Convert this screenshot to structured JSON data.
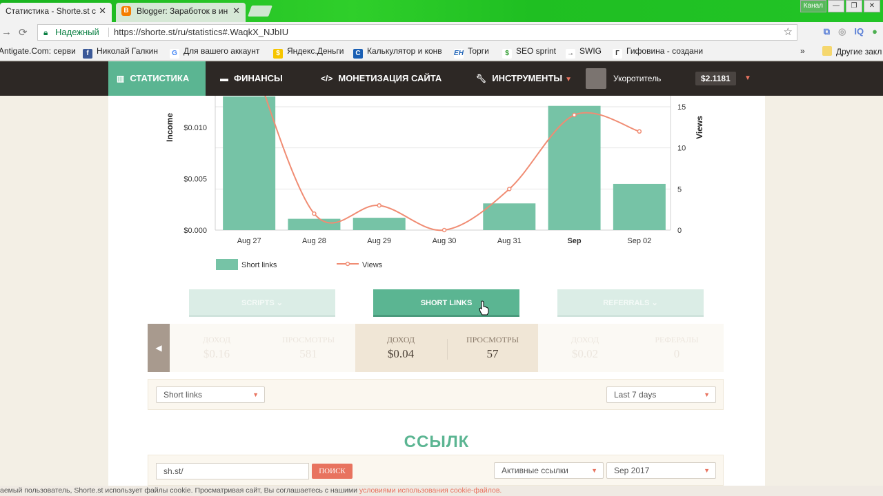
{
  "browser": {
    "tabs": [
      {
        "title": "Статистика - Shorte.st c"
      },
      {
        "title": "Blogger: Заработок в ин"
      }
    ],
    "window_user": "Канал",
    "secure_label": "Надежный",
    "url": "https://shorte.st/ru/statistics#.WaqkX_NJbIU",
    "bookmarks": [
      "Antigate.Com: серви",
      "Николай Галкин",
      "Для вашего аккаунт",
      "Яндекс.Деньги",
      "Калькулятор и конв",
      "Торги",
      "SEO sprint",
      "SWIG",
      "Гифовина - создани"
    ],
    "other_bookmarks": "Другие закл",
    "overflow": "»"
  },
  "nav": {
    "items": [
      "СТАТИСТИКА",
      "ФИНАНСЫ",
      "МОНЕТИЗАЦИЯ САЙТА",
      "ИНСТРУМЕНТЫ"
    ],
    "user": "Укоротитель",
    "balance": "$2.1181"
  },
  "chart_data": {
    "type": "bar",
    "categories": [
      "Aug 27",
      "Aug 28",
      "Aug 29",
      "Aug 30",
      "Aug 31",
      "Sep",
      "Sep 02"
    ],
    "series": [
      {
        "name": "Short links",
        "values": [
          0.0135,
          0.0011,
          0.0012,
          0.0,
          0.0026,
          0.0121,
          0.0045
        ],
        "color": "#76c3a6",
        "axis": "left"
      },
      {
        "name": "Views",
        "values": [
          22,
          2,
          3,
          0,
          5,
          14,
          12
        ],
        "color": "#f08c73",
        "axis": "right",
        "type": "line"
      }
    ],
    "ylabel": "Income",
    "y2label": "Views",
    "left_ticks": [
      "$0.000",
      "$0.005",
      "$0.010"
    ],
    "right_ticks": [
      "0",
      "5",
      "10",
      "15"
    ],
    "ylim": [
      0,
      0.01
    ],
    "y2lim": [
      0,
      15
    ],
    "bold_category": "Sep",
    "legend": "bottom-left"
  },
  "toggles": [
    "SCRIPTS",
    "SHORT LINKS",
    "REFERRALS"
  ],
  "stats": {
    "left": [
      {
        "label": "ДОХОД",
        "value": "$0.16"
      },
      {
        "label": "ПРОСМОТРЫ",
        "value": "581"
      }
    ],
    "center": [
      {
        "label": "ДОХОД",
        "value": "$0.04"
      },
      {
        "label": "ПРОСМОТРЫ",
        "value": "57"
      }
    ],
    "right": [
      {
        "label": "ДОХОД",
        "value": "$0.02"
      },
      {
        "label": "РЕФЕРАЛЫ",
        "value": "0"
      }
    ]
  },
  "filters": {
    "type": "Short links",
    "period": "Last 7 days"
  },
  "links_title": "ССЫЛК",
  "search": {
    "value": "sh.st/",
    "button": "ПОИСК",
    "status": "Активные ссылки",
    "month": "Sep 2017"
  },
  "cookie": {
    "text": "аемый пользователь, Shorte.st использует файлы cookie. Просматривая сайт, Вы соглашаетесь с нашими ",
    "link": "условиями использования cookie-файлов."
  },
  "colors": {
    "accent": "#5bb592",
    "nav_bg": "#2d2825",
    "coral": "#e8735f",
    "bar": "#76c3a6",
    "line": "#f08c73"
  }
}
